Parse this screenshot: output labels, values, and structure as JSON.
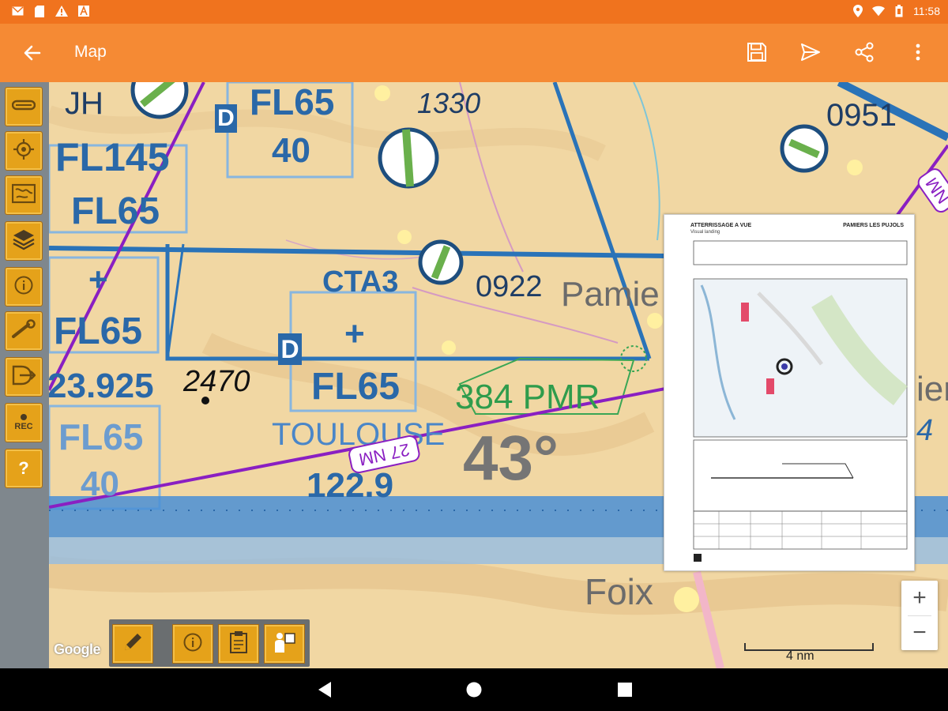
{
  "status_bar": {
    "time": "11:58",
    "left_icons": [
      "mail-icon",
      "sim-card-icon",
      "warning-icon",
      "app-a-icon"
    ],
    "right_icons": [
      "location-icon",
      "wifi-icon",
      "battery-icon"
    ]
  },
  "app_bar": {
    "title": "Map",
    "actions": [
      "save-icon",
      "send-icon",
      "share-icon",
      "more-vert-icon"
    ]
  },
  "left_toolbar": {
    "items": [
      {
        "name": "route-tool",
        "icon": "route-icon"
      },
      {
        "name": "locate-tool",
        "icon": "crosshair-icon"
      },
      {
        "name": "map-tool",
        "icon": "map-icon"
      },
      {
        "name": "layers-tool",
        "icon": "layers-icon"
      },
      {
        "name": "info-tool",
        "icon": "info-icon"
      },
      {
        "name": "settings-tool",
        "icon": "wrench-icon"
      },
      {
        "name": "export-tool",
        "icon": "export-icon"
      },
      {
        "name": "record-tool",
        "icon": "record-icon",
        "label": "REC"
      },
      {
        "name": "help-tool",
        "icon": "help-icon",
        "label": "?"
      }
    ]
  },
  "map": {
    "labels": {
      "jh": "JH",
      "d1": "D",
      "fl65_a": "FL65",
      "v40_a": "40",
      "fl145": "FL145",
      "fl65_b": "FL65",
      "plus_a": "+",
      "fl65_c": "FL65",
      "freq_a": "23.925",
      "fl65_d": "FL65",
      "v40_b": "40",
      "elev_1330": "1330",
      "elev_0951": "0951",
      "cta3": "CTA3",
      "d2": "D",
      "plus_b": "+",
      "fl65_e": "FL65",
      "num_0922": "0922",
      "pamiers": "Pamie",
      "elev_2470": "2470",
      "pmr": "384 PMR",
      "toulouse": "TOULOUSE",
      "freq_b": "122.9",
      "deg": "43°",
      "foix": "Foix",
      "right_cut": "ier",
      "right_num": "4",
      "route_label_1": "27 NM",
      "route_label_2": "NM"
    },
    "approach_chart": {
      "header": "ATTERRISSAGE A VUE",
      "subheader": "Visual landing",
      "airport": "PAMIERS LES PUJOLS"
    },
    "zoom": {
      "plus": "+",
      "minus": "−"
    },
    "scale_label": "4 nm",
    "google_label": "Google"
  },
  "bottom_tools": {
    "items": [
      "pencil-icon",
      "info-icon",
      "clipboard-icon",
      "person-board-icon"
    ]
  },
  "nav_bar": {
    "items": [
      "back-triangle-icon",
      "home-circle-icon",
      "recents-square-icon"
    ]
  },
  "colors": {
    "status_bar": "#f0731e",
    "app_bar": "#f58a34",
    "tool_button": "#e5a21a",
    "airspace_blue": "#2a68a8",
    "route_purple": "#8a1fc2"
  }
}
